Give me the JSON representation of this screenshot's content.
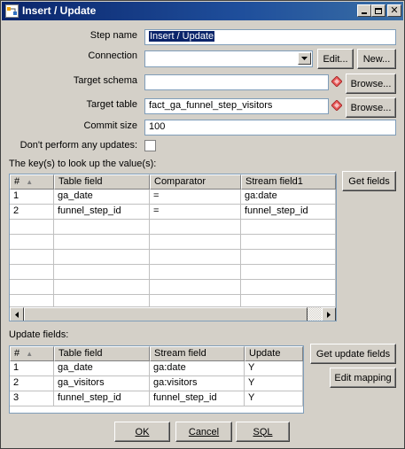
{
  "window": {
    "title": "Insert / Update",
    "icon": "pdi-transform-icon"
  },
  "form": {
    "step_name_label": "Step name",
    "step_name_value": "Insert / Update",
    "connection_label": "Connection",
    "connection_value": "",
    "edit_label": "Edit...",
    "new_label": "New...",
    "target_schema_label": "Target schema",
    "target_schema_value": "",
    "browse_label": "Browse...",
    "target_table_label": "Target table",
    "target_table_value": "fact_ga_funnel_step_visitors",
    "commit_size_label": "Commit size",
    "commit_size_value": "100",
    "no_updates_label": "Don't perform any updates:",
    "no_updates_checked": false
  },
  "keys": {
    "section_label": "The key(s) to look up the value(s):",
    "get_fields_label": "Get fields",
    "columns": [
      "#",
      "Table field",
      "Comparator",
      "Stream field1"
    ],
    "rows": [
      [
        "1",
        "ga_date",
        "=",
        "ga:date"
      ],
      [
        "2",
        "funnel_step_id",
        "=",
        "funnel_step_id"
      ]
    ]
  },
  "updates": {
    "section_label": "Update fields:",
    "get_update_fields_label": "Get update fields",
    "edit_mapping_label": "Edit mapping",
    "columns": [
      "#",
      "Table field",
      "Stream field",
      "Update"
    ],
    "rows": [
      [
        "1",
        "ga_date",
        "ga:date",
        "Y"
      ],
      [
        "2",
        "ga_visitors",
        "ga:visitors",
        "Y"
      ],
      [
        "3",
        "funnel_step_id",
        "funnel_step_id",
        "Y"
      ]
    ]
  },
  "footer": {
    "ok_label": "OK",
    "cancel_label": "Cancel",
    "sql_label": "SQL"
  }
}
